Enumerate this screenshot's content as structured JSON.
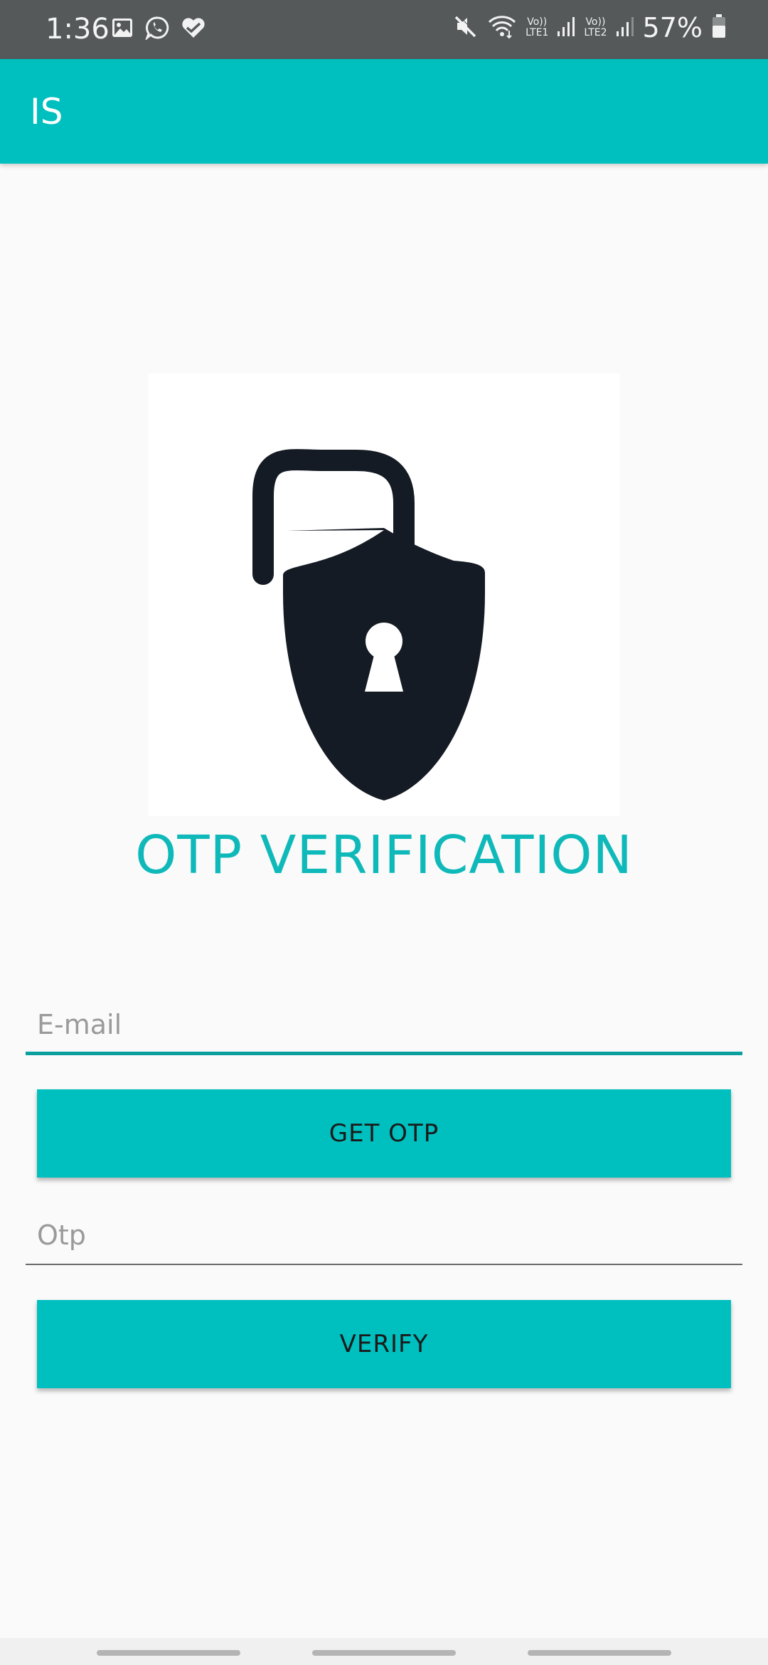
{
  "status_bar": {
    "time": "1:36",
    "lte1_top": "Vo))",
    "lte1_bottom": "LTE1",
    "lte2_top": "Vo))",
    "lte2_bottom": "LTE2",
    "battery_pct": "57%"
  },
  "app_bar": {
    "title": "IS"
  },
  "main": {
    "heading": "OTP VERIFICATION",
    "email_field": {
      "value": "",
      "placeholder": "E-mail"
    },
    "get_otp_label": "GET OTP",
    "otp_field": {
      "value": "",
      "placeholder": "Otp"
    },
    "verify_label": "VERIFY"
  },
  "colors": {
    "accent": "#00bfbf",
    "status_bar": "#55595a",
    "heading": "#10b9b9",
    "focused_underline": "#0a9e9e",
    "lock": "#151b24"
  },
  "icons": {
    "status_left": [
      "gallery-icon",
      "whatsapp-icon",
      "health-icon"
    ],
    "status_right": [
      "mute-icon",
      "wifi-icon",
      "signal-icon",
      "signal-icon",
      "battery-icon"
    ],
    "hero": "shield-padlock-icon"
  }
}
